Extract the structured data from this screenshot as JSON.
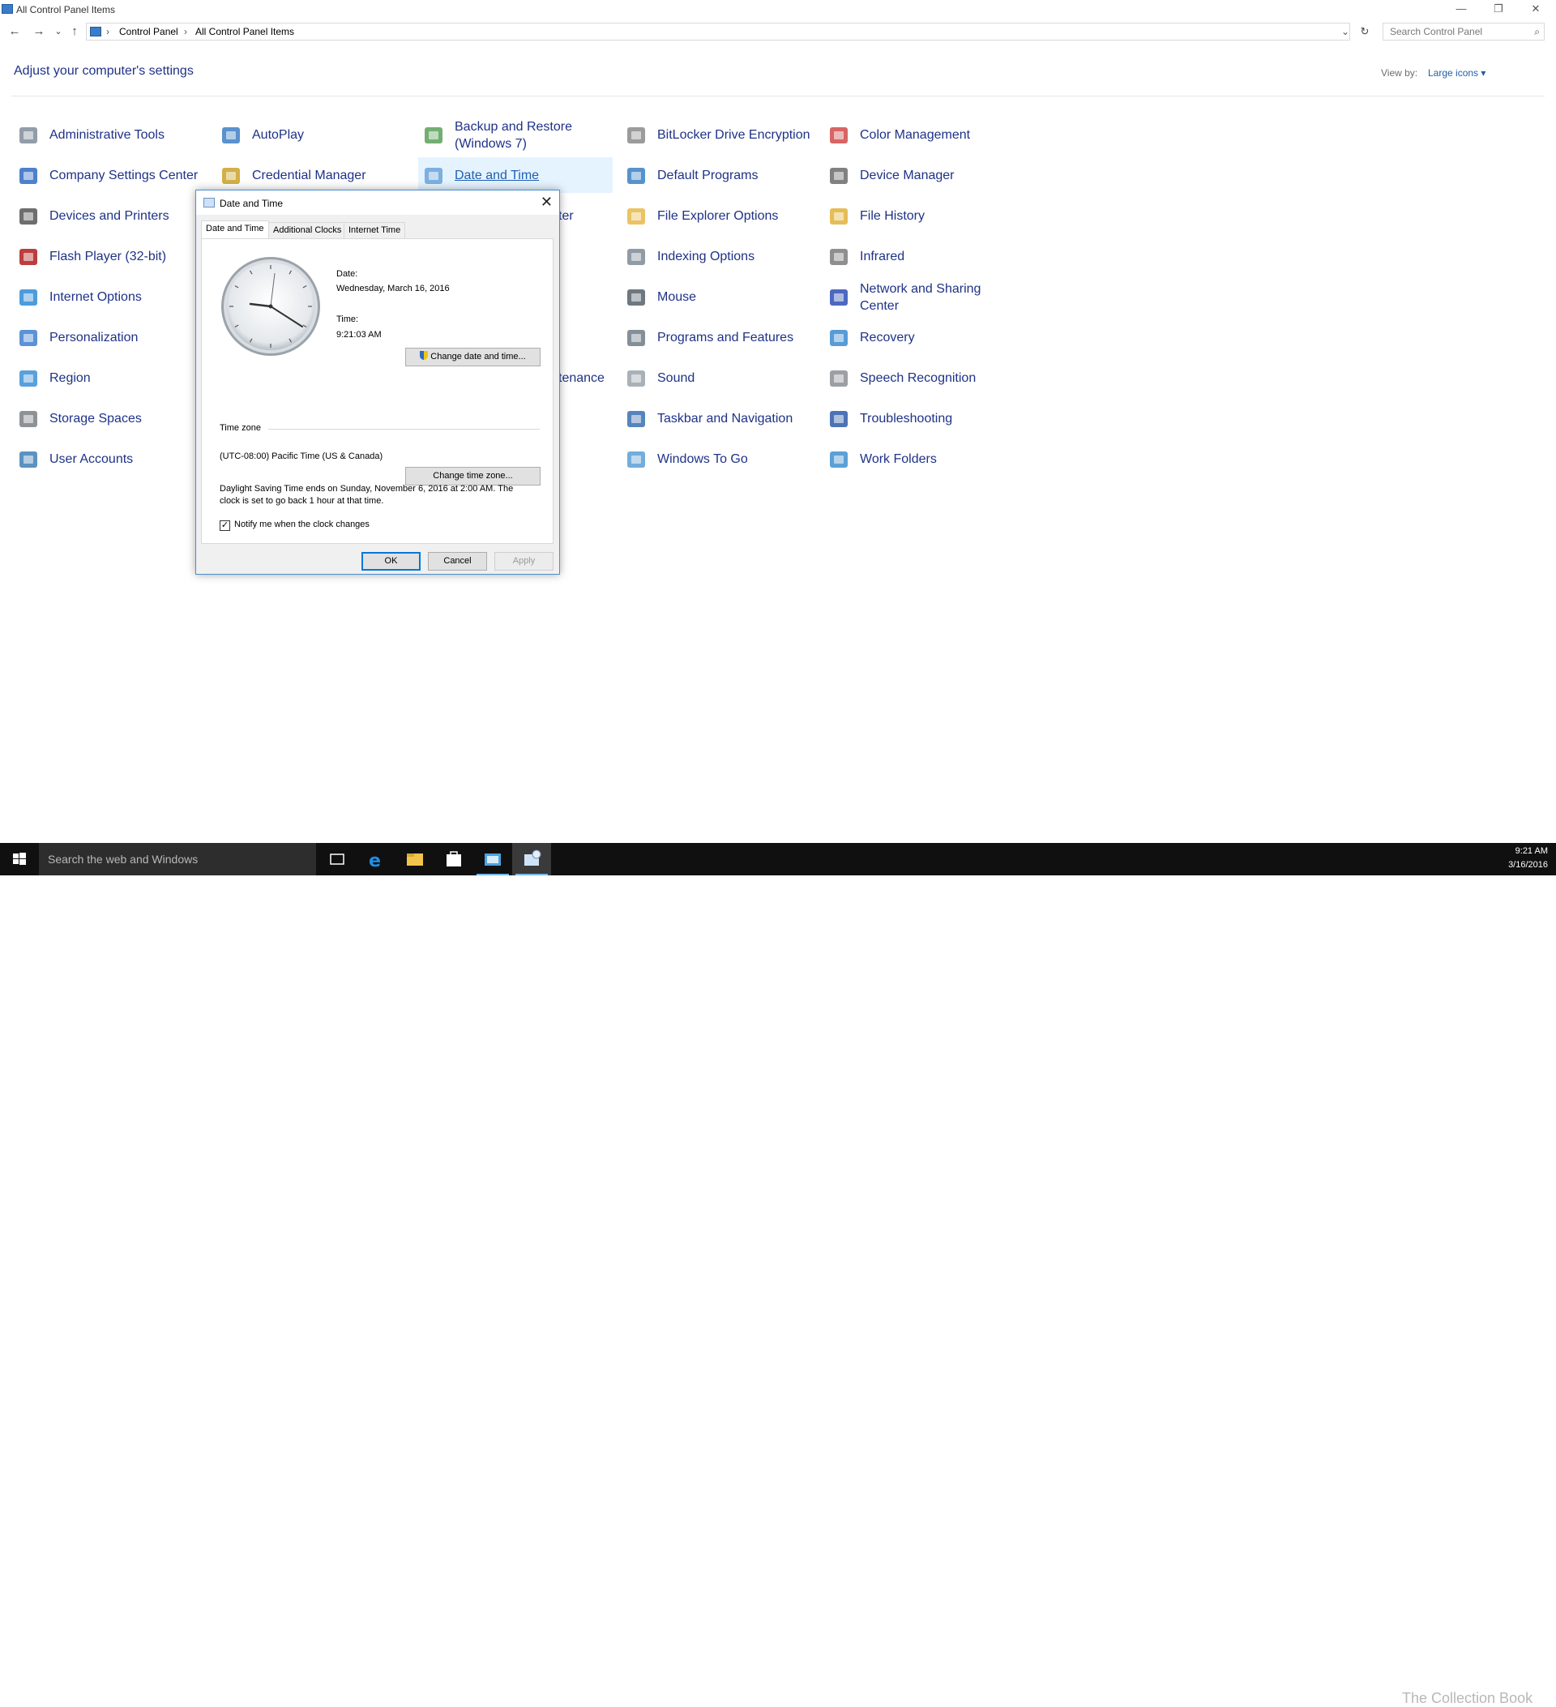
{
  "window": {
    "title": "All Control Panel Items",
    "minimize": "—",
    "restore": "❐",
    "close": "✕"
  },
  "nav": {
    "back": "←",
    "forward": "→",
    "recent": "⌄",
    "up": "↑",
    "breadcrumb": [
      "Control Panel",
      "All Control Panel Items"
    ],
    "separator": "›",
    "dropdown": "⌄",
    "refresh": "↻",
    "search_placeholder": "Search Control Panel",
    "search_icon": "⌕"
  },
  "page": {
    "heading": "Adjust your computer's settings",
    "view_by_label": "View by:",
    "view_by_value": "Large icons ▾"
  },
  "items": [
    {
      "label": "Administrative Tools",
      "icon": "admin-tools-icon"
    },
    {
      "label": "AutoPlay",
      "icon": "autoplay-icon"
    },
    {
      "label": "Backup and Restore (Windows 7)",
      "icon": "backup-icon"
    },
    {
      "label": "BitLocker Drive Encryption",
      "icon": "bitlocker-icon"
    },
    {
      "label": "Color Management",
      "icon": "color-management-icon"
    },
    {
      "label": "Company Settings Center",
      "icon": "company-settings-icon"
    },
    {
      "label": "Credential Manager",
      "icon": "credential-manager-icon"
    },
    {
      "label": "Date and Time",
      "icon": "date-time-icon"
    },
    {
      "label": "Default Programs",
      "icon": "default-programs-icon"
    },
    {
      "label": "Device Manager",
      "icon": "device-manager-icon"
    },
    {
      "label": "Devices and Printers",
      "icon": "devices-printers-icon"
    },
    {
      "label": "File Explorer Options",
      "icon": "file-explorer-options-icon"
    },
    {
      "label": "File History",
      "icon": "file-history-icon"
    },
    {
      "label": "Flash Player (32-bit)",
      "icon": "flash-player-icon"
    },
    {
      "label": "Indexing Options",
      "icon": "indexing-options-icon"
    },
    {
      "label": "Infrared",
      "icon": "infrared-icon"
    },
    {
      "label": "Internet Options",
      "icon": "internet-options-icon"
    },
    {
      "label": "Mouse",
      "icon": "mouse-icon"
    },
    {
      "label": "Network and Sharing Center",
      "icon": "network-sharing-icon"
    },
    {
      "label": "Personalization",
      "icon": "personalization-icon"
    },
    {
      "label": "Programs and Features",
      "icon": "programs-features-icon"
    },
    {
      "label": "Recovery",
      "icon": "recovery-icon"
    },
    {
      "label": "Region",
      "icon": "region-icon"
    },
    {
      "label": "Sound",
      "icon": "sound-icon"
    },
    {
      "label": "Speech Recognition",
      "icon": "speech-recognition-icon"
    },
    {
      "label": "Storage Spaces",
      "icon": "storage-spaces-icon"
    },
    {
      "label": "Taskbar and Navigation",
      "icon": "taskbar-navigation-icon"
    },
    {
      "label": "Troubleshooting",
      "icon": "troubleshooting-icon"
    },
    {
      "label": "User Accounts",
      "icon": "user-accounts-icon"
    },
    {
      "label": "Windows To Go",
      "icon": "windows-to-go-icon"
    },
    {
      "label": "Work Folders",
      "icon": "work-folders-icon"
    }
  ],
  "partially_hidden": {
    "item_a_tail": "ter",
    "item_b_tail": "tenance"
  },
  "dialog": {
    "title": "Date and Time",
    "close": "✕",
    "tabs": [
      "Date and Time",
      "Additional Clocks",
      "Internet Time"
    ],
    "date_label": "Date:",
    "date_value": "Wednesday, March 16, 2016",
    "time_label": "Time:",
    "time_value": "9:21:03 AM",
    "change_datetime_button": "Change date and time...",
    "time_zone_label": "Time zone",
    "time_zone_value": "(UTC-08:00) Pacific Time (US & Canada)",
    "change_tz_button": "Change time zone...",
    "dst_line1": "Daylight Saving Time ends on Sunday, November 6, 2016 at 2:00 AM. The",
    "dst_line2": "clock is set to go back 1 hour at that time.",
    "notify_label": "Notify me when the clock changes",
    "notify_checked": "✓",
    "ok": "OK",
    "cancel": "Cancel",
    "apply": "Apply"
  },
  "taskbar": {
    "search_placeholder": "Search the web and Windows",
    "apps": [
      "task-view-icon",
      "edge-icon",
      "file-explorer-icon",
      "store-icon",
      "control-panel-icon",
      "date-time-app-icon"
    ],
    "clock_time": "9:21 AM",
    "clock_date": "3/16/2016",
    "watermark": "The Collection Book"
  },
  "colors": {
    "link_blue": "#1e3287",
    "accent": "#0078d7",
    "taskbar": "#101010"
  }
}
